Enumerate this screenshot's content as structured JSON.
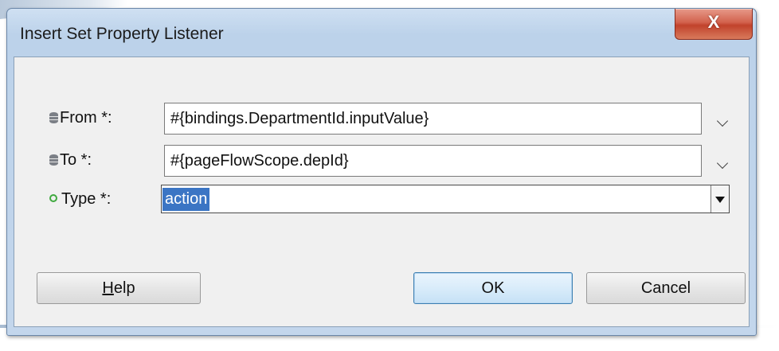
{
  "dialog": {
    "title": "Insert Set Property Listener",
    "close_label": "X"
  },
  "form": {
    "from": {
      "label": "From *:",
      "value": "#{bindings.DepartmentId.inputValue}",
      "icon": "database-icon"
    },
    "to": {
      "label": "To *:",
      "value": "#{pageFlowScope.depId}",
      "icon": "database-icon"
    },
    "type": {
      "label": "Type *:",
      "value": "action",
      "icon": "green-circle-icon"
    }
  },
  "buttons": {
    "help_mnemonic": "H",
    "help_rest": "elp",
    "ok": "OK",
    "cancel": "Cancel"
  },
  "colors": {
    "selection": "#3b75c4",
    "close_button": "#c1432c",
    "window_frame": "#bcd2ea"
  }
}
